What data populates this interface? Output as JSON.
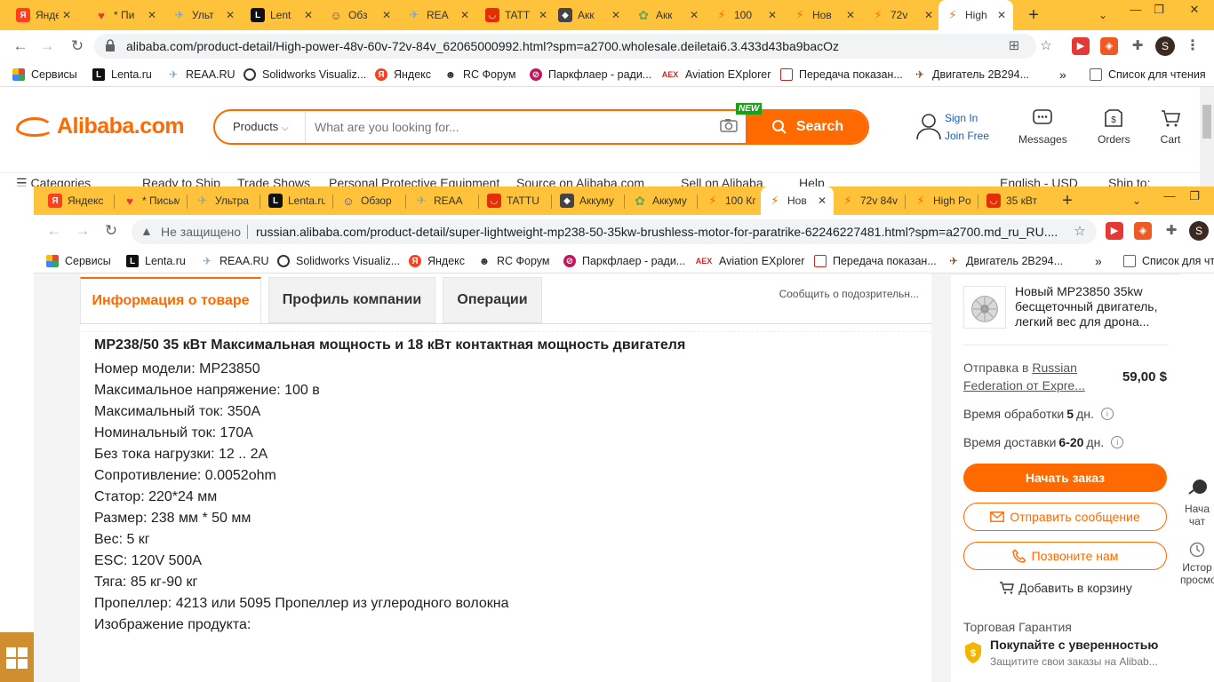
{
  "back_window": {
    "tabs": [
      {
        "label": "Янде",
        "icon": "yandex-icon",
        "color": "#fc3f1d",
        "glyph": "Я"
      },
      {
        "label": "* Пи",
        "icon": "mail-heart-icon",
        "color": "#e53935",
        "glyph": "♥"
      },
      {
        "label": "Ульт",
        "icon": "reaa-icon",
        "color": "#7ea6c9",
        "glyph": "✈"
      },
      {
        "label": "Lent",
        "icon": "lenta-icon",
        "color": "#111111",
        "glyph": "L"
      },
      {
        "label": "Обз",
        "icon": "person-icon",
        "color": "#5a4a8a",
        "glyph": "☺"
      },
      {
        "label": "REA",
        "icon": "reaa-icon",
        "color": "#7ea6c9",
        "glyph": "✈"
      },
      {
        "label": "TATT",
        "icon": "aliexpress-icon",
        "color": "#e62e04",
        "glyph": "◡"
      },
      {
        "label": "Акк",
        "icon": "site-icon",
        "color": "#444444",
        "glyph": "◆"
      },
      {
        "label": "Акк",
        "icon": "dots-icon",
        "color": "#6aa84f",
        "glyph": "✿"
      },
      {
        "label": "100",
        "icon": "alibaba-icon",
        "color": "#ff6a00",
        "glyph": "⚡"
      },
      {
        "label": "Нов",
        "icon": "alibaba-icon",
        "color": "#ff6a00",
        "glyph": "⚡"
      },
      {
        "label": "72v",
        "icon": "alibaba-icon",
        "color": "#ff6a00",
        "glyph": "⚡"
      },
      {
        "label": "High",
        "icon": "alibaba-icon",
        "color": "#ff6a00",
        "glyph": "⚡",
        "active": true
      }
    ],
    "url": "alibaba.com/product-detail/High-power-48v-60v-72v-84v_62065000992.html?spm=a2700.wholesale.deiletai6.3.433d43ba9bacOz",
    "profile_letter": "S",
    "bookmarks": [
      {
        "label": "Сервисы",
        "icon": "apps-grid-icon"
      },
      {
        "label": "Lenta.ru",
        "icon": "lenta-icon"
      },
      {
        "label": "REAA.RU",
        "icon": "reaa-icon"
      },
      {
        "label": "Solidworks Visualiz...",
        "icon": "solidworks-icon"
      },
      {
        "label": "Яндекс",
        "icon": "yandex-icon"
      },
      {
        "label": "RC Форум",
        "icon": "rc-forum-icon"
      },
      {
        "label": "Паркфлаер - ради...",
        "icon": "parkflyer-icon"
      },
      {
        "label": "Aviation EXplorer",
        "icon": "aex-icon"
      },
      {
        "label": "Передача показан...",
        "icon": "doc-icon"
      },
      {
        "label": "Двигатель 2В294...",
        "icon": "plane-icon"
      }
    ],
    "reading_list": "Список для чтения",
    "alibaba": {
      "logo": "Alibaba.com",
      "search_category": "Products",
      "search_placeholder": "What are you looking for...",
      "new_badge": "NEW",
      "search_button": "Search",
      "sign_in": "Sign In",
      "join_free": "Join Free",
      "messages": "Messages",
      "orders": "Orders",
      "cart": "Cart",
      "categories": [
        "Categories",
        "Ready to Ship",
        "Trade Shows",
        "Personal Protective Equipment",
        "Source on Alibaba.com",
        "Sell on Alibaba",
        "Help",
        "English - USD",
        "Ship to:"
      ]
    }
  },
  "front_window": {
    "tabs": [
      {
        "label": "Яндекс",
        "color": "#fc3f1d",
        "glyph": "Я"
      },
      {
        "label": "* Письм",
        "color": "#e53935",
        "glyph": "♥"
      },
      {
        "label": "Ультра",
        "color": "#7ea6c9",
        "glyph": "✈"
      },
      {
        "label": "Lenta.ru",
        "color": "#111111",
        "glyph": "L"
      },
      {
        "label": "Обзор",
        "color": "#5a4a8a",
        "glyph": "☺"
      },
      {
        "label": "REAA",
        "color": "#7ea6c9",
        "glyph": "✈"
      },
      {
        "label": "TATTU",
        "color": "#e62e04",
        "glyph": "◡"
      },
      {
        "label": "Аккуму",
        "color": "#444444",
        "glyph": "◆"
      },
      {
        "label": "Аккуму",
        "color": "#6aa84f",
        "glyph": "✿"
      },
      {
        "label": "100 Кг",
        "color": "#ff6a00",
        "glyph": "⚡"
      },
      {
        "label": "Нов",
        "color": "#ff6a00",
        "glyph": "⚡",
        "active": true
      },
      {
        "label": "72v 84v",
        "color": "#ff6a00",
        "glyph": "⚡"
      },
      {
        "label": "High Po",
        "color": "#ff6a00",
        "glyph": "⚡"
      },
      {
        "label": "35 кВт",
        "color": "#e62e04",
        "glyph": "◡"
      }
    ],
    "security_label": "Не защищено",
    "url": "russian.alibaba.com/product-detail/super-lightweight-mp238-50-35kw-brushless-motor-for-paratrike-62246227481.html?spm=a2700.md_ru_RU....",
    "profile_letter": "S",
    "reading_list": "Список для чте",
    "page": {
      "tabs": [
        "Информация о товаре",
        "Профиль компании",
        "Операции"
      ],
      "report_link": "Сообщить о подозрительн...",
      "spec_title": "MP238/50 35 кВт Максимальная мощность и 18 кВт контактная мощность двигателя",
      "specs": [
        "Номер модели: MP23850",
        "Максимальное напряжение: 100 в",
        "Максимальный ток: 350А",
        "Номинальный ток: 170А",
        "Без тока нагрузки: 12 .. 2A",
        "Сопротивление: 0.0052ohm",
        "Статор: 220*24 мм",
        "Размер: 238 мм * 50 мм",
        "Вес: 5 кг",
        "ESC: 120V 500A",
        "Тяга: 85 кг-90 кг",
        "Пропеллер: 4213 или 5095 Пропеллер из углеродного волокна",
        "Изображение продукта:"
      ],
      "sidebar": {
        "product_name": "Новый MP23850 35kw бесщеточный двигатель, легкий вес для дрона...",
        "ship_prefix": "Отправка в ",
        "ship_link": "Russian Federation от Expre...",
        "price": "59,00 $",
        "processing_label": "Время обработки",
        "processing_value": "5",
        "processing_unit": "дн.",
        "delivery_label": "Время доставки",
        "delivery_value": "6-20",
        "delivery_unit": "дн.",
        "start_order": "Начать заказ",
        "send_message": "Отправить сообщение",
        "call_us": "Позвоните нам",
        "add_to_cart": "Добавить в корзину",
        "trade_assurance": "Торговая Гарантия",
        "buy_confidence": "Покупайте с уверенностью",
        "protect_orders": "Защитите свои заказы на Alibab..."
      },
      "float_bar": {
        "chat": "Нача чат",
        "history": "Истор просмо"
      }
    }
  },
  "colors": {
    "tab_bar": "#ffc23b",
    "alibaba_orange": "#ff6a00",
    "new_badge": "#18a218"
  }
}
